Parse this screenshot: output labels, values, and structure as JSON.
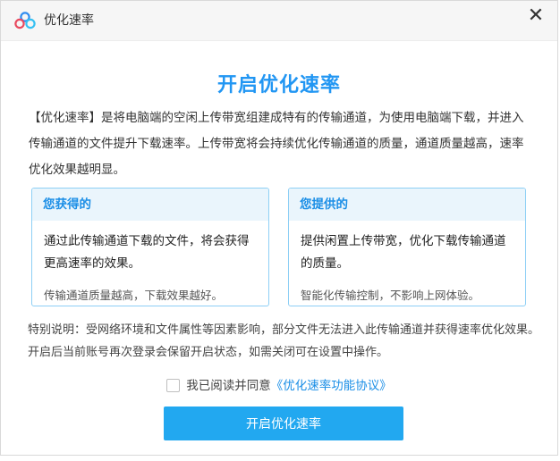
{
  "window": {
    "title": "优化速率",
    "close_symbol": "✕"
  },
  "dialog": {
    "heading": "开启优化速率",
    "intro": "【优化速率】是将电脑端的空闲上传带宽组建成特有的传输通道，为使用电脑端下载，并进入传输通道的文件提升下载速率。上传带宽将会持续优化传输通道的质量，通道质量越高，速率优化效果越明显。",
    "cards": [
      {
        "title": "您获得的",
        "body": "通过此传输通道下载的文件，将会获得更高速率的效果。",
        "footnote": "传输通道质量越高，下载效果越好。"
      },
      {
        "title": "您提供的",
        "body": "提供闲置上传带宽，优化下载传输通道的质量。",
        "footnote": "智能化传输控制，不影响上网体验。"
      }
    ],
    "notice": "特别说明：受网络环境和文件属性等因素影响，部分文件无法进入此传输通道并获得速率优化效果。开启后当前账号再次登录会保留开启状态，如需关闭可在设置中操作。",
    "agreement": {
      "checked": false,
      "text": "我已阅读并同意",
      "link": "《优化速率功能协议》"
    },
    "submit_label": "开启优化速率"
  },
  "colors": {
    "accent": "#2196f3",
    "button": "#22a8f0",
    "card_border": "#8dcff5",
    "card_header": "#eaf5fc"
  },
  "icons": {
    "logo": "baidu-netdisk-cloud-icon",
    "close": "close-icon"
  }
}
